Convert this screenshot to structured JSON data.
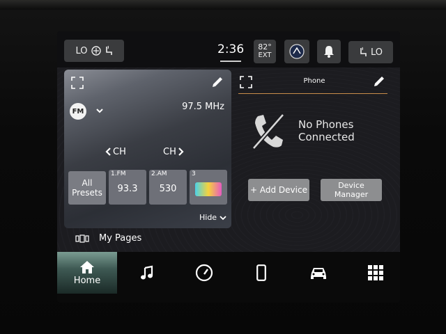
{
  "status_bar": {
    "left_control": {
      "label": "LO",
      "icons": [
        "fan-icon",
        "seat-heat-icon"
      ]
    },
    "time": "2:36",
    "temperature": {
      "value": "82°",
      "label": "EXT"
    },
    "right_control": {
      "label": "LO",
      "icons": [
        "seat-heat-icon"
      ]
    }
  },
  "radio_card": {
    "band": "FM",
    "frequency": "97.5 MHz",
    "ch_prev_label": "CH",
    "ch_next_label": "CH",
    "all_presets_label": "All Presets",
    "presets": [
      {
        "number": "1.FM",
        "value": "93.3"
      },
      {
        "number": "2.AM",
        "value": "530"
      },
      {
        "number": "3",
        "value": ""
      }
    ],
    "hide_label": "Hide"
  },
  "phone_card": {
    "title": "Phone",
    "status_text": "No Phones Connected",
    "add_device_label": "+ Add Device",
    "device_manager_label": "Device Manager",
    "accent_color": "#c98d4a"
  },
  "my_pages_label": "My Pages",
  "nav": {
    "items": [
      {
        "name": "home",
        "label": "Home",
        "icon": "home-icon",
        "active": true
      },
      {
        "name": "media",
        "label": "",
        "icon": "music-note-icon"
      },
      {
        "name": "performance",
        "label": "",
        "icon": "gauge-icon"
      },
      {
        "name": "phone",
        "label": "",
        "icon": "phone-icon"
      },
      {
        "name": "vehicle",
        "label": "",
        "icon": "car-icon"
      },
      {
        "name": "apps",
        "label": "",
        "icon": "grid-icon"
      }
    ]
  }
}
